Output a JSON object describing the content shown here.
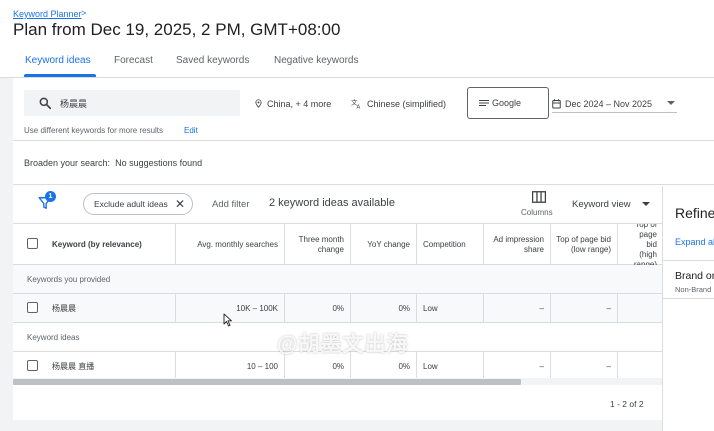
{
  "header": {
    "breadcrumb": "Keyword Planner",
    "breadcrumb_chevron": ">",
    "title": "Plan from Dec 19, 2025, 2 PM, GMT+08:00",
    "tabs": [
      {
        "label": "Keyword ideas",
        "active": true
      },
      {
        "label": "Forecast",
        "active": false
      },
      {
        "label": "Saved keywords",
        "active": false
      },
      {
        "label": "Negative keywords",
        "active": false
      }
    ]
  },
  "search": {
    "query": "杨晨晨",
    "location": "China, + 4 more",
    "language": "Chinese (simplified)",
    "network": "Google",
    "date_range": "Dec 2024 – Nov 2025",
    "hint": "Use different keywords for more results",
    "hint_link": "Edit"
  },
  "broaden": {
    "label": "Broaden your search:",
    "value": "No suggestions found"
  },
  "toolbar": {
    "filter_count": "1",
    "chip_label": "Exclude adult ideas",
    "add_filter": "Add filter",
    "ideas_count": "2 keyword ideas available",
    "columns_label": "Columns",
    "keyword_view": "Keyword view"
  },
  "table": {
    "columns": [
      "Keyword (by relevance)",
      "Avg. monthly searches",
      "Three month change",
      "YoY change",
      "Competition",
      "Ad impression share",
      "Top of page bid (low range)",
      "Top of page bid (high range)"
    ],
    "groups": [
      {
        "label": "Keywords you provided",
        "rows": [
          {
            "keyword": "杨晨晨",
            "searches": "10K – 100K",
            "three_month": "0%",
            "yoy": "0%",
            "competition": "Low",
            "impression": "–",
            "bid_low": "–"
          }
        ]
      },
      {
        "label": "Keyword ideas",
        "rows": [
          {
            "keyword": "杨晨晨 直播",
            "searches": "10 – 100",
            "three_month": "0%",
            "yoy": "0%",
            "competition": "Low",
            "impression": "–",
            "bid_low": "–"
          }
        ]
      }
    ],
    "pager": "1 - 2 of 2"
  },
  "refine": {
    "title": "Refine keywords",
    "expand": "Expand all",
    "brand_title": "Brand or Non-Brand",
    "brand_sub": "Non-Brand"
  },
  "watermark": "@胡墨文出海",
  "colors": {
    "accent": "#1a73e8",
    "text": "#202124",
    "muted": "#5f6368",
    "border": "#dadce0"
  }
}
